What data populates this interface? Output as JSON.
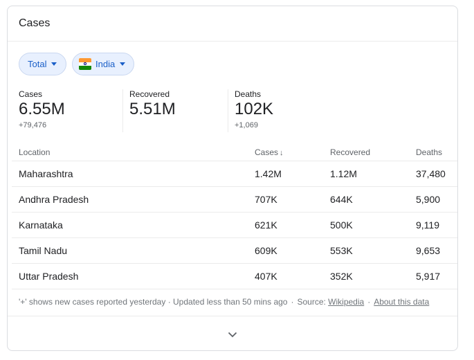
{
  "card": {
    "title": "Cases"
  },
  "filters": {
    "scope_label": "Total",
    "country_label": "India",
    "country_flag": "india-flag-icon"
  },
  "stats": {
    "cases": {
      "label": "Cases",
      "value": "6.55M",
      "delta": "+79,476"
    },
    "recovered": {
      "label": "Recovered",
      "value": "5.51M"
    },
    "deaths": {
      "label": "Deaths",
      "value": "102K",
      "delta": "+1,069"
    }
  },
  "table": {
    "headers": {
      "location": "Location",
      "cases": "Cases",
      "recovered": "Recovered",
      "deaths": "Deaths"
    },
    "sort_icon": "arrow-down-icon",
    "rows": [
      {
        "location": "Maharashtra",
        "cases": "1.42M",
        "recovered": "1.12M",
        "deaths": "37,480"
      },
      {
        "location": "Andhra Pradesh",
        "cases": "707K",
        "recovered": "644K",
        "deaths": "5,900"
      },
      {
        "location": "Karnataka",
        "cases": "621K",
        "recovered": "500K",
        "deaths": "9,119"
      },
      {
        "location": "Tamil Nadu",
        "cases": "609K",
        "recovered": "553K",
        "deaths": "9,653"
      },
      {
        "location": "Uttar Pradesh",
        "cases": "407K",
        "recovered": "352K",
        "deaths": "5,917"
      }
    ]
  },
  "footer": {
    "note": "'+' shows new cases reported yesterday · Updated less than 50 mins ago",
    "source_label": "Source:",
    "source_link": "Wikipedia",
    "about_link": "About this data",
    "separator": "·"
  },
  "colors": {
    "chip_bg": "#e8f0fe",
    "chip_text": "#1a5fc8",
    "text": "#202124",
    "muted": "#5f6368"
  }
}
